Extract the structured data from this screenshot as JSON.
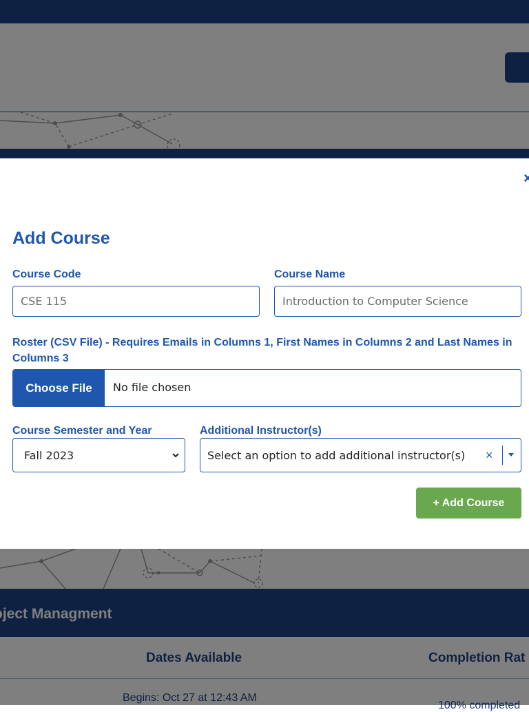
{
  "background": {
    "section_title": "oject Managment",
    "table": {
      "columns": [
        "Dates Available",
        "Completion Rat"
      ],
      "row": {
        "dates": "Begins: Oct 27 at 12:43 AM",
        "completion": "100% completed"
      }
    }
  },
  "modal": {
    "close_symbol": "×",
    "title": "Add Course",
    "course_code": {
      "label": "Course Code",
      "placeholder": "CSE 115"
    },
    "course_name": {
      "label": "Course Name",
      "placeholder": "Introduction to Computer Science"
    },
    "roster": {
      "label": "Roster (CSV File) - Requires Emails in Columns 1, First Names in Columns 2 and Last Names in Columns 3",
      "button_label": "Choose File",
      "status": "No file chosen"
    },
    "semester": {
      "label": "Course Semester and Year",
      "selected": "Fall 2023"
    },
    "instructors": {
      "label": "Additional Instructor(s)",
      "placeholder": "Select an option to add additional instructor(s)",
      "clear_symbol": "×"
    },
    "submit_label": "+ Add Course"
  },
  "colors": {
    "primary": "#1f56ae",
    "navy": "#1f4386",
    "success": "#6aa84f",
    "overlay": "rgba(0,0,0,0.5)"
  }
}
